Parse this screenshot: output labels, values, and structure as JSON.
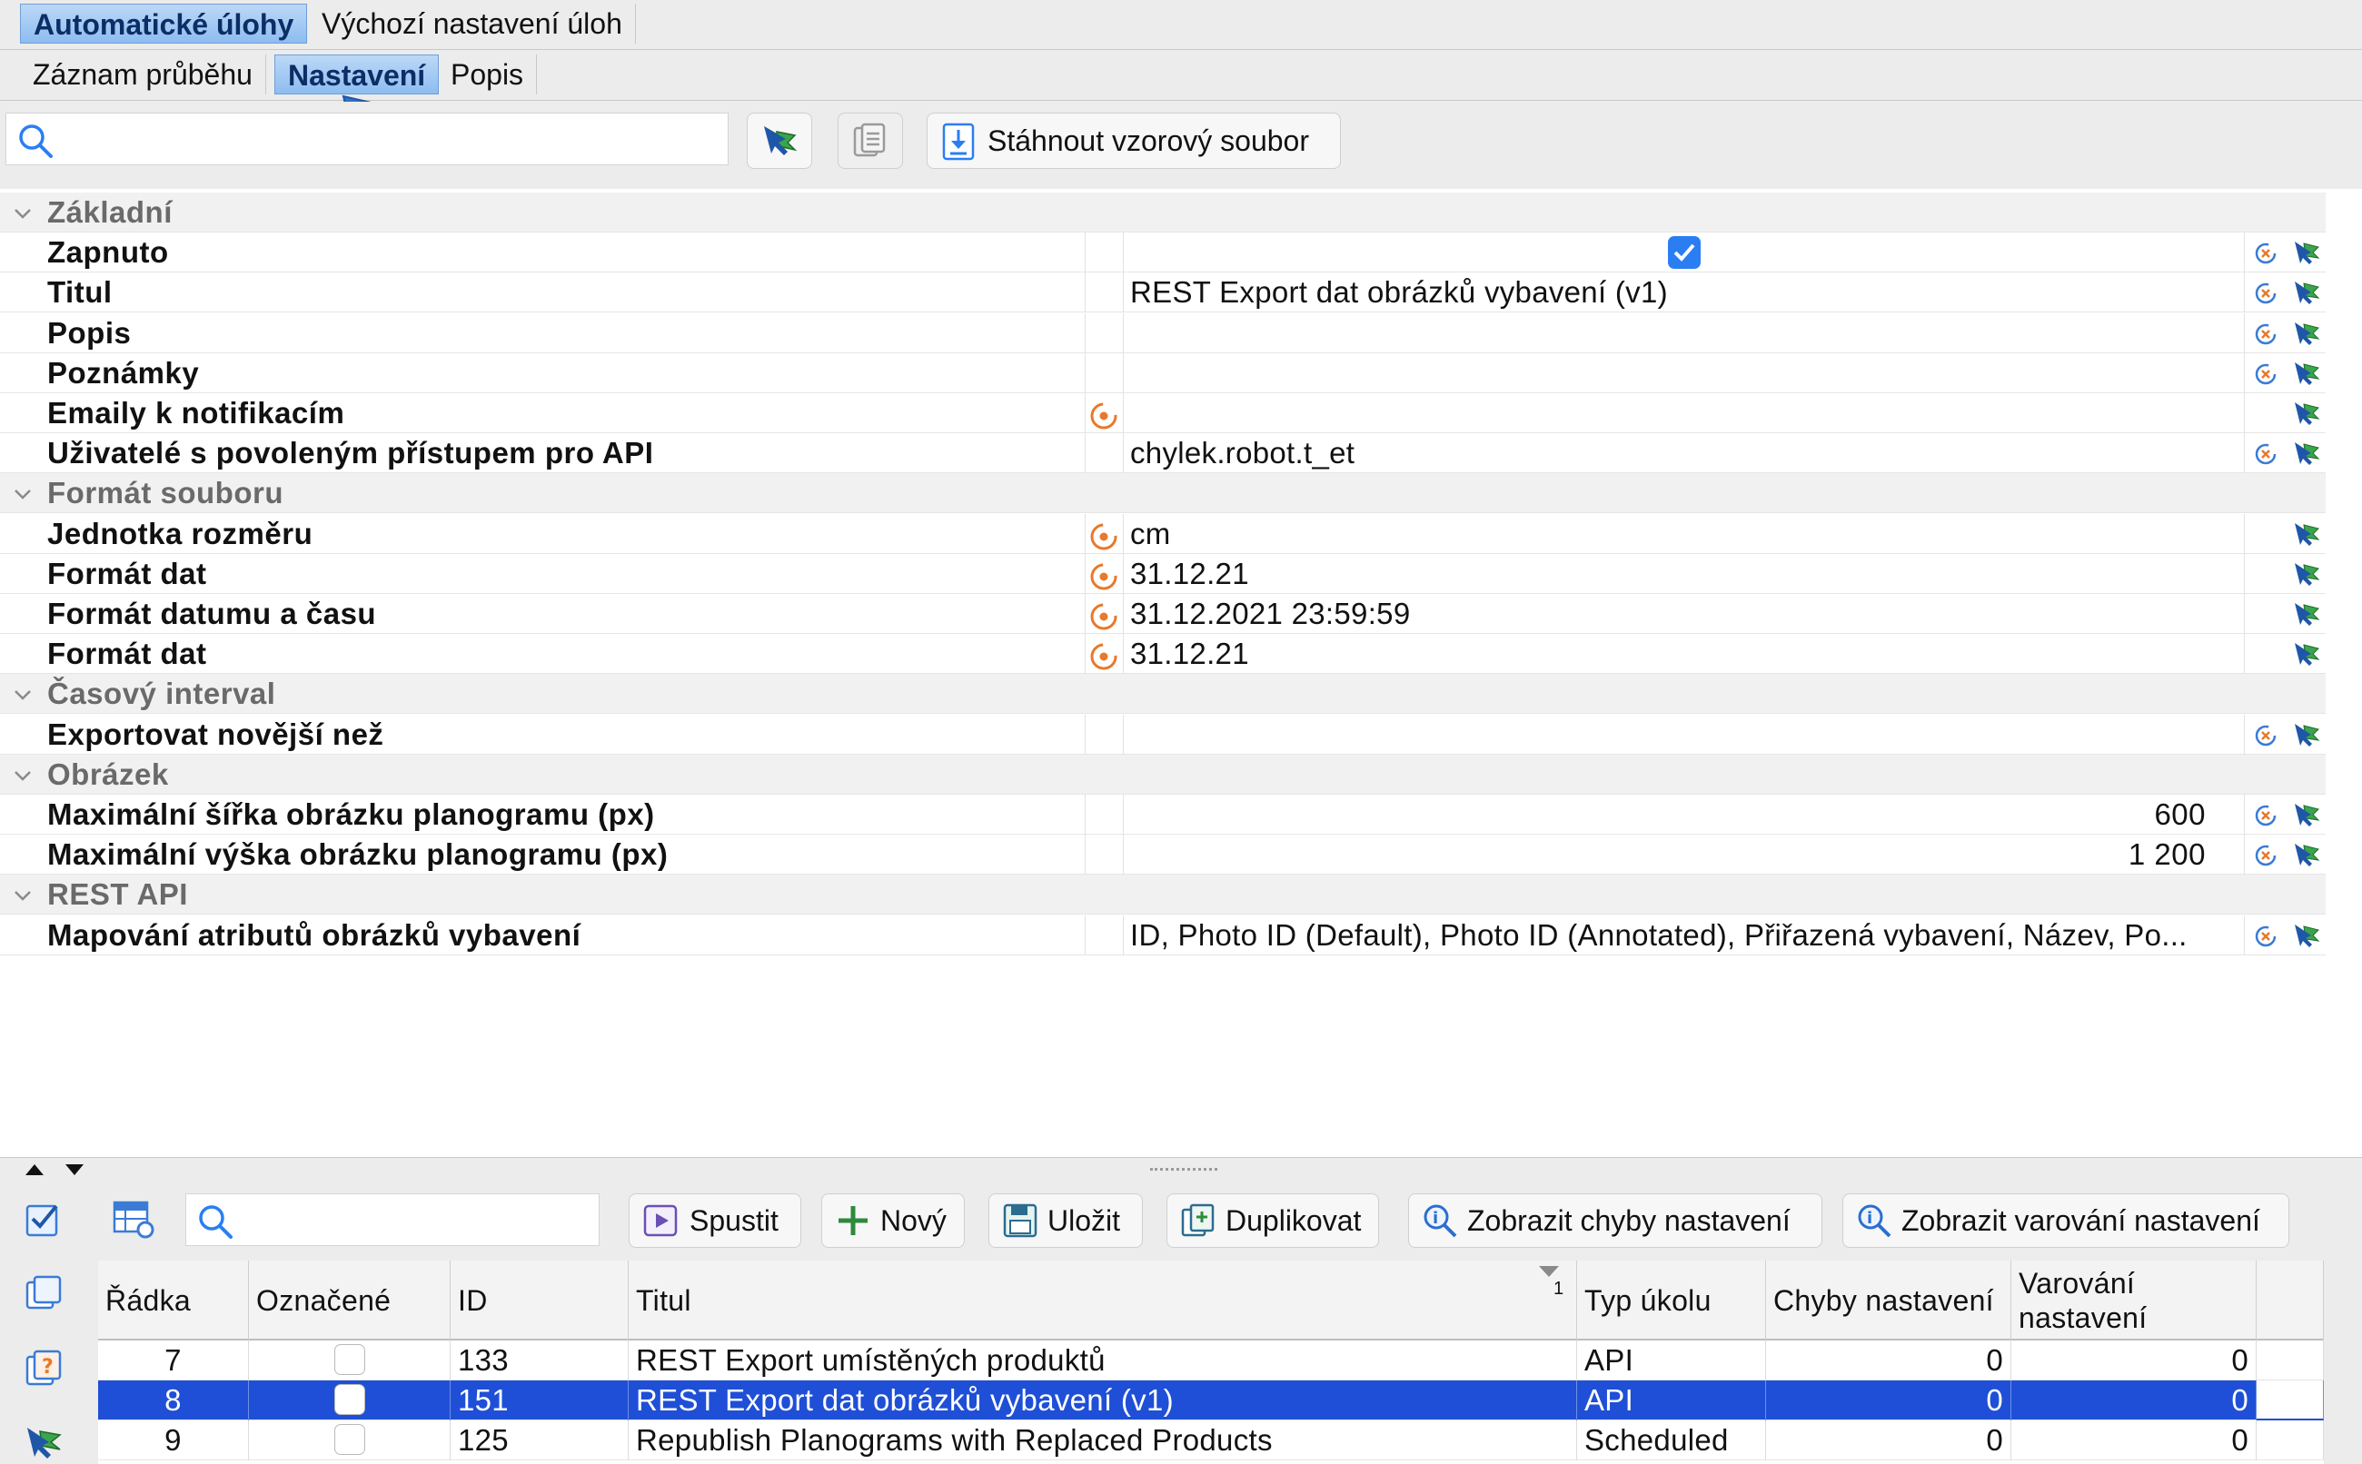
{
  "top_tabs": [
    {
      "label": "Automatické úlohy",
      "active": true
    },
    {
      "label": "Výchozí nastavení úloh",
      "active": false
    }
  ],
  "sub_tabs": [
    {
      "label": "Záznam průběhu",
      "active": false
    },
    {
      "label": "Nastavení",
      "active": true
    },
    {
      "label": "Popis",
      "active": false
    }
  ],
  "toolbar": {
    "search_placeholder": "",
    "download_label": "Stáhnout vzorový soubor"
  },
  "properties": [
    {
      "type": "category",
      "label": "Základní"
    },
    {
      "type": "prop",
      "label": "Zapnuto",
      "value": "",
      "checkbox": true,
      "checked": true,
      "orig": false,
      "reset": true
    },
    {
      "type": "prop",
      "label": "Titul",
      "value": "REST Export dat obrázků vybavení (v1)",
      "orig": false,
      "reset": true
    },
    {
      "type": "prop",
      "label": "Popis",
      "value": "",
      "orig": false,
      "reset": true
    },
    {
      "type": "prop",
      "label": "Poznámky",
      "value": "",
      "orig": false,
      "reset": true
    },
    {
      "type": "prop",
      "label": "Emaily k notifikacím",
      "value": "",
      "orig": true,
      "reset": false
    },
    {
      "type": "prop",
      "label": "Uživatelé s povoleným přístupem pro API",
      "value": "chylek.robot.t_et",
      "orig": false,
      "reset": true
    },
    {
      "type": "category",
      "label": "Formát souboru"
    },
    {
      "type": "prop",
      "label": "Jednotka rozměru",
      "value": "cm",
      "orig": true,
      "reset": false
    },
    {
      "type": "prop",
      "label": "Formát dat",
      "value": "31.12.21",
      "orig": true,
      "reset": false
    },
    {
      "type": "prop",
      "label": "Formát datumu a času",
      "value": "31.12.2021 23:59:59",
      "orig": true,
      "reset": false
    },
    {
      "type": "prop",
      "label": "Formát dat",
      "value": "31.12.21",
      "orig": true,
      "reset": false
    },
    {
      "type": "category",
      "label": "Časový interval"
    },
    {
      "type": "prop",
      "label": "Exportovat novější než",
      "value": "",
      "orig": false,
      "reset": true
    },
    {
      "type": "category",
      "label": "Obrázek"
    },
    {
      "type": "prop",
      "label": "Maximální šířka obrázku planogramu (px)",
      "value": "600",
      "align": "right",
      "orig": false,
      "reset": true
    },
    {
      "type": "prop",
      "label": "Maximální výška obrázku planogramu (px)",
      "value": "1 200",
      "align": "right",
      "orig": false,
      "reset": true
    },
    {
      "type": "category",
      "label": "REST API"
    },
    {
      "type": "prop",
      "label": "Mapování atributů obrázků vybavení",
      "value": "ID, Photo ID (Default), Photo ID (Annotated), Přiřazená vybavení, Název, Po...",
      "orig": false,
      "reset": true
    }
  ],
  "bottom_toolbar": {
    "search_placeholder": "",
    "run_label": "Spustit",
    "new_label": "Nový",
    "save_label": "Uložit",
    "duplicate_label": "Duplikovat",
    "show_errors_label": "Zobrazit chyby nastavení",
    "show_warnings_label": "Zobrazit varování nastavení"
  },
  "table": {
    "columns": [
      "Řádka",
      "Označené",
      "ID",
      "Titul",
      "Typ úkolu",
      "Chyby nastavení",
      "Varování nastavení"
    ],
    "sort_indicator": "1",
    "rows": [
      {
        "row": "7",
        "checked": false,
        "id": "133",
        "title": "REST Export umístěných produktů",
        "type": "API",
        "errors": "0",
        "warnings": "0",
        "selected": false
      },
      {
        "row": "8",
        "checked": false,
        "id": "151",
        "title": "REST Export dat obrázků vybavení (v1)",
        "type": "API",
        "errors": "0",
        "warnings": "0",
        "selected": true
      },
      {
        "row": "9",
        "checked": false,
        "id": "125",
        "title": "Republish Planograms with Replaced Products",
        "type": "Scheduled",
        "errors": "0",
        "warnings": "0",
        "selected": false
      }
    ]
  },
  "colors": {
    "accent": "#2a7ef2",
    "selection": "#1f4fd6",
    "arrow": "#2f6fc8",
    "orig_icon": "#e8792b"
  }
}
